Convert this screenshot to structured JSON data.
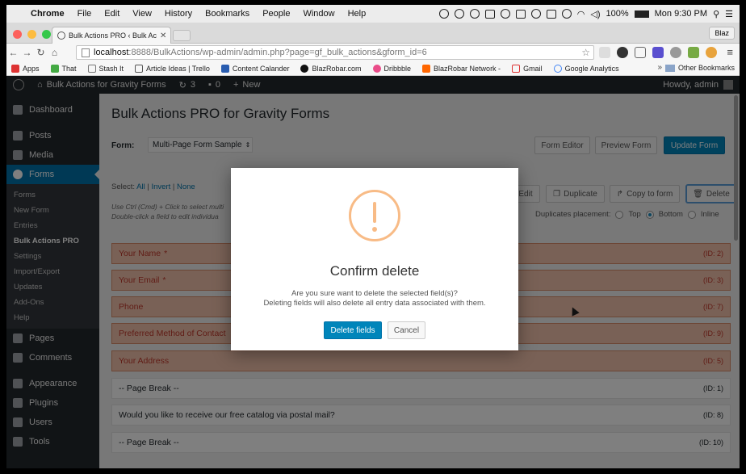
{
  "mac_menubar": {
    "app": "Chrome",
    "menus": [
      "File",
      "Edit",
      "View",
      "History",
      "Bookmarks",
      "People",
      "Window",
      "Help"
    ],
    "battery": "100%",
    "clock": "Mon 9:30 PM"
  },
  "browser": {
    "tab_title": "Bulk Actions PRO ‹ Bulk Ac",
    "profile": "Blaz",
    "url_host": "localhost",
    "url_path": ":8888/BulkActions/wp-admin/admin.php?page=gf_bulk_actions&gform_id=6",
    "bookmarks": [
      "Apps",
      "That",
      "Stash It",
      "Article Ideas | Trello",
      "Content Calander",
      "BlazRobar.com",
      "Dribbble",
      "BlazRobar Network -",
      "Gmail",
      "Google Analytics"
    ],
    "other_bookmarks": "Other Bookmarks",
    "more": "»"
  },
  "adminbar": {
    "site_name": "Bulk Actions for Gravity Forms",
    "updates": "3",
    "comments": "0",
    "new_label": "New",
    "howdy": "Howdy, admin"
  },
  "sidebar": {
    "dashboard": "Dashboard",
    "posts": "Posts",
    "media": "Media",
    "forms": "Forms",
    "submenu": [
      "Forms",
      "New Form",
      "Entries",
      "Bulk Actions PRO",
      "Settings",
      "Import/Export",
      "Updates",
      "Add-Ons",
      "Help"
    ],
    "pages": "Pages",
    "comments": "Comments",
    "appearance": "Appearance",
    "plugins": "Plugins",
    "users": "Users",
    "tools": "Tools"
  },
  "main": {
    "title": "Bulk Actions PRO for Gravity Forms",
    "form_label": "Form:",
    "form_select": "Multi-Page Form Sample",
    "btn_form_editor": "Form Editor",
    "btn_preview": "Preview Form",
    "btn_update": "Update Form",
    "select_label": "Select:",
    "select_all": "All",
    "select_invert": "Invert",
    "select_none": "None",
    "hint1": "Use Ctrl (Cmd) + Click to select multi",
    "hint2": "Double-click a field to edit individua",
    "btn_edit": "Edit",
    "btn_duplicate": "Duplicate",
    "btn_copy": "Copy to form",
    "btn_delete": "Delete",
    "dup_label": "Duplicates placement:",
    "dup_options": [
      "Top",
      "Bottom",
      "Inline"
    ],
    "fields": [
      {
        "label": "Your Name",
        "req": "*",
        "id": "(ID: 2)",
        "selected": true
      },
      {
        "label": "Your Email",
        "req": "*",
        "id": "(ID: 3)",
        "selected": true
      },
      {
        "label": "Phone",
        "req": "",
        "id": "(ID: 7)",
        "selected": true
      },
      {
        "label": "Preferred Method of Contact",
        "req": "",
        "id": "(ID: 9)",
        "selected": true
      },
      {
        "label": "Your Address",
        "req": "",
        "id": "(ID: 5)",
        "selected": true
      },
      {
        "label": "-- Page Break --",
        "req": "",
        "id": "(ID: 1)",
        "selected": false
      },
      {
        "label": "Would you like to receive our free catalog via postal mail?",
        "req": "",
        "id": "(ID: 8)",
        "selected": false
      },
      {
        "label": "-- Page Break --",
        "req": "",
        "id": "(ID: 10)",
        "selected": false
      }
    ]
  },
  "modal": {
    "title": "Confirm delete",
    "line1": "Are you sure want to delete the selected field(s)?",
    "line2": "Deleting fields will also delete all entry data associated with them.",
    "confirm": "Delete fields",
    "cancel": "Cancel"
  }
}
